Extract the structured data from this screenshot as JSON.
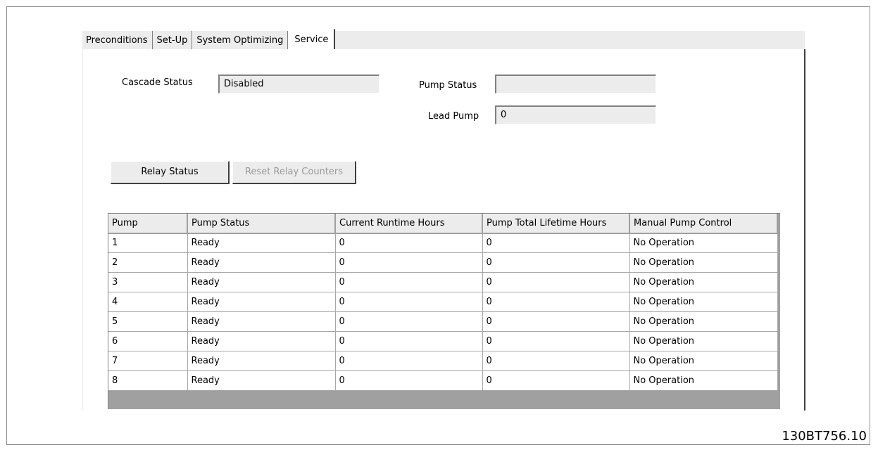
{
  "tabs": [
    "Preconditions",
    "Set-Up",
    "System Optimizing",
    "Service"
  ],
  "active_tab": "Service",
  "cascade_status": {
    "label": "Cascade Status",
    "value": "Disabled"
  },
  "pump_status": {
    "label": "Pump Status",
    "value": ""
  },
  "lead_pump": {
    "label": "Lead Pump",
    "value": "0"
  },
  "buttons": {
    "relay_status": "Relay Status",
    "reset_relay_counters": "Reset Relay Counters"
  },
  "table": {
    "headers": [
      "Pump",
      "Pump Status",
      "Current Runtime Hours",
      "Pump Total Lifetime Hours",
      "Manual Pump Control"
    ],
    "rows": [
      [
        "1",
        "Ready",
        "0",
        "0",
        "No Operation"
      ],
      [
        "2",
        "Ready",
        "0",
        "0",
        "No Operation"
      ],
      [
        "3",
        "Ready",
        "0",
        "0",
        "No Operation"
      ],
      [
        "4",
        "Ready",
        "0",
        "0",
        "No Operation"
      ],
      [
        "5",
        "Ready",
        "0",
        "0",
        "No Operation"
      ],
      [
        "6",
        "Ready",
        "0",
        "0",
        "No Operation"
      ],
      [
        "7",
        "Ready",
        "0",
        "0",
        "No Operation"
      ],
      [
        "8",
        "Ready",
        "0",
        "0",
        "No Operation"
      ]
    ]
  },
  "figure_ref": "130BT756.10"
}
